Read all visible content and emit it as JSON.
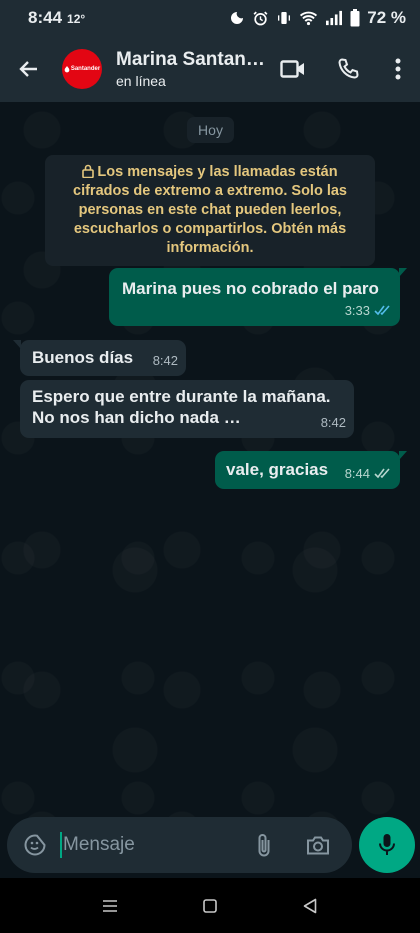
{
  "status_bar": {
    "time": "8:44",
    "temperature": "12°",
    "battery": "72 %"
  },
  "header": {
    "contact_name": "Marina Santan…",
    "contact_status": "en línea",
    "avatar_brand": "Santander"
  },
  "chat": {
    "date_chip": "Hoy",
    "encryption_notice": "Los mensajes y las llamadas están cifrados de extremo a extremo. Solo las personas en este chat pueden leerlos, escucharlos o compartirlos. Obtén más información.",
    "messages": [
      {
        "direction": "outgoing",
        "text": "Marina pues no cobrado el paro",
        "time": "3:33",
        "status": "read"
      },
      {
        "direction": "incoming",
        "text": "Buenos días",
        "time": "8:42"
      },
      {
        "direction": "incoming",
        "text": "Espero que entre durante la mañana. No nos han dicho nada …",
        "time": "8:42"
      },
      {
        "direction": "outgoing",
        "text": "vale, gracias",
        "time": "8:44",
        "status": "delivered"
      }
    ]
  },
  "composer": {
    "placeholder": "Mensaje"
  },
  "colors": {
    "background": "#0b141a",
    "header": "#1f2c34",
    "outgoing_bubble": "#005c4b",
    "incoming_bubble": "#1f2c34",
    "accent": "#00a884",
    "read_ticks": "#53bdeb",
    "notice_text": "#e4c77e"
  }
}
